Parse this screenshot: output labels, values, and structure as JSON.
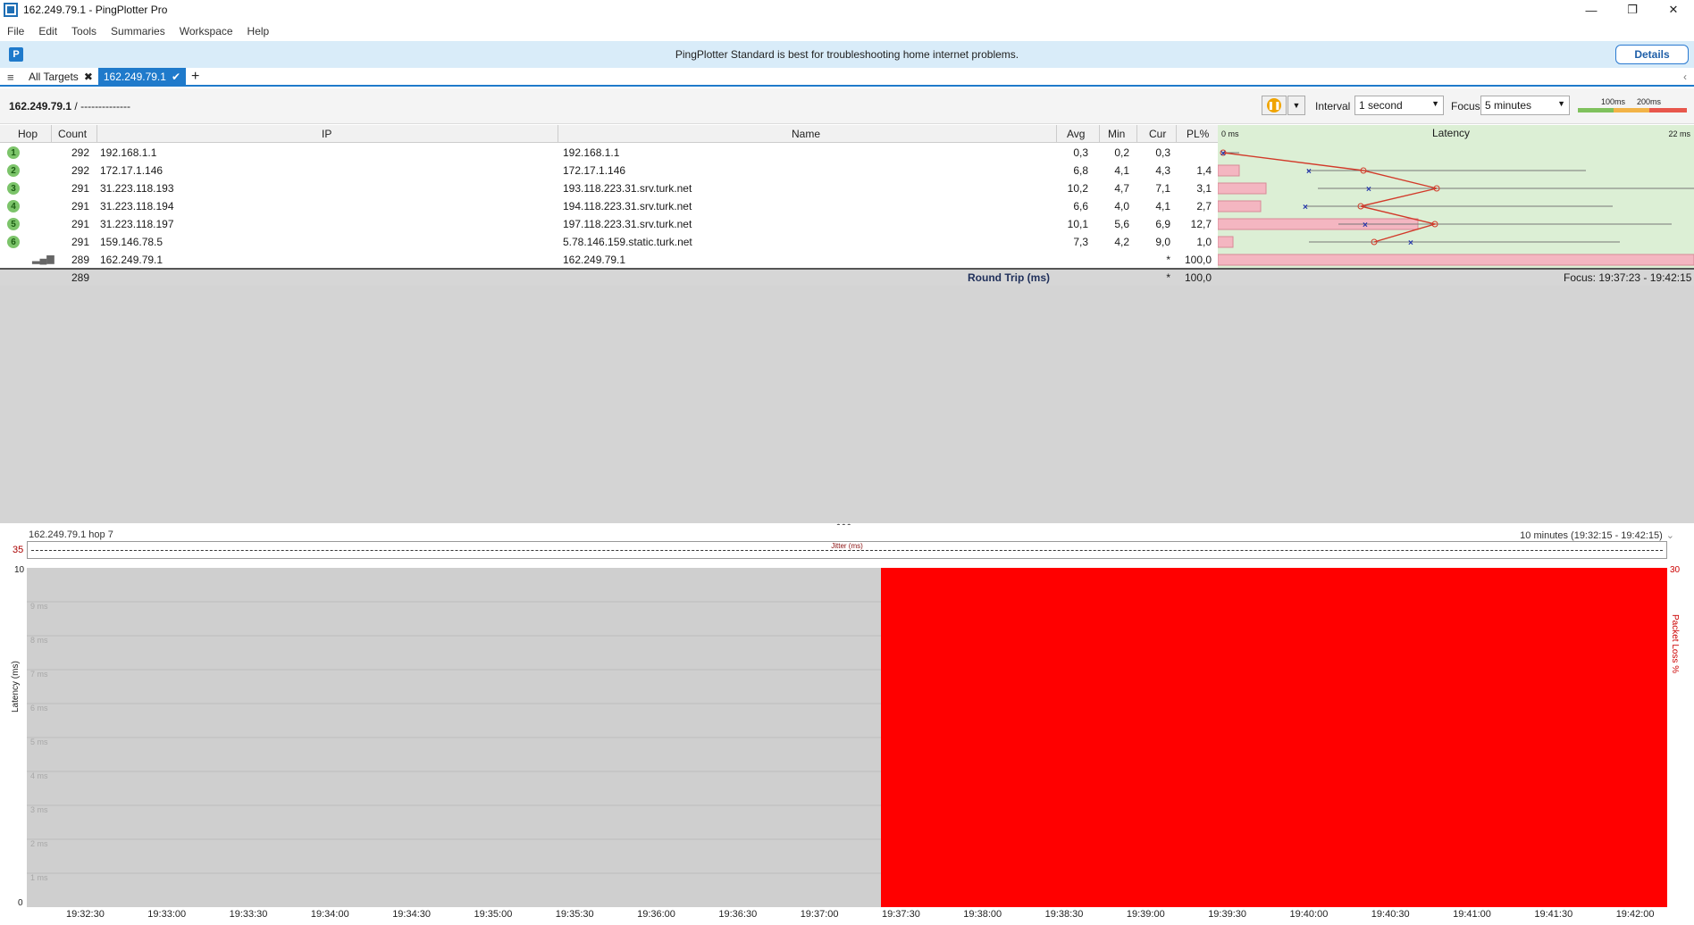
{
  "window": {
    "title": "162.249.79.1 - PingPlotter Pro",
    "controls": [
      "—",
      "❐",
      "✕"
    ]
  },
  "menu": [
    "File",
    "Edit",
    "Tools",
    "Summaries",
    "Workspace",
    "Help"
  ],
  "banner": {
    "message": "PingPlotter Standard is best for troubleshooting home internet problems.",
    "details_label": "Details"
  },
  "tabs": {
    "all_targets": "All Targets",
    "active": "162.249.79.1",
    "add": "+"
  },
  "toolbar": {
    "crumb_target": "162.249.79.1",
    "crumb_rest": " /  --------------",
    "interval_label": "Interval",
    "interval_value": "1 second",
    "focus_label": "Focus",
    "focus_value": "5 minutes",
    "scale_100": "100ms",
    "scale_200": "200ms"
  },
  "table": {
    "headers": {
      "hop": "Hop",
      "count": "Count",
      "ip": "IP",
      "name": "Name",
      "avg": "Avg",
      "min": "Min",
      "cur": "Cur",
      "pl": "PL%",
      "latency": "Latency",
      "lat_min": "0 ms",
      "lat_max": "22 ms"
    },
    "rows": [
      {
        "hop": "1",
        "count": "292",
        "ip": "192.168.1.1",
        "name": "192.168.1.1",
        "avg": "0,3",
        "min": "0,2",
        "cur": "0,3",
        "pl": ""
      },
      {
        "hop": "2",
        "count": "292",
        "ip": "172.17.1.146",
        "name": "172.17.1.146",
        "avg": "6,8",
        "min": "4,1",
        "cur": "4,3",
        "pl": "1,4"
      },
      {
        "hop": "3",
        "count": "291",
        "ip": "31.223.118.193",
        "name": "193.118.223.31.srv.turk.net",
        "avg": "10,2",
        "min": "4,7",
        "cur": "7,1",
        "pl": "3,1"
      },
      {
        "hop": "4",
        "count": "291",
        "ip": "31.223.118.194",
        "name": "194.118.223.31.srv.turk.net",
        "avg": "6,6",
        "min": "4,0",
        "cur": "4,1",
        "pl": "2,7"
      },
      {
        "hop": "5",
        "count": "291",
        "ip": "31.223.118.197",
        "name": "197.118.223.31.srv.turk.net",
        "avg": "10,1",
        "min": "5,6",
        "cur": "6,9",
        "pl": "12,7"
      },
      {
        "hop": "6",
        "count": "291",
        "ip": "159.146.78.5",
        "name": "5.78.146.159.static.turk.net",
        "avg": "7,3",
        "min": "4,2",
        "cur": "9,0",
        "pl": "1,0"
      },
      {
        "hop": "",
        "count": "289",
        "ip": "162.249.79.1",
        "name": "162.249.79.1",
        "avg": "",
        "min": "",
        "cur": "*",
        "pl": "100,0"
      }
    ],
    "round_trip": {
      "count": "289",
      "label": "Round Trip (ms)",
      "cur": "*",
      "pl": "100,0",
      "focus": "Focus: 19:37:23 - 19:42:15"
    }
  },
  "bottom_chart": {
    "title_left": "162.249.79.1 hop 7",
    "title_right": "10 minutes (19:32:15 - 19:42:15)",
    "jitter_label": "Jitter (ms)",
    "jitter_max": "35",
    "y_left_top": "10",
    "y_left_bottom": "0",
    "y_right_top": "30",
    "y_title_left": "Latency (ms)",
    "y_title_right": "Packet Loss %",
    "y_ticks": [
      "9 ms",
      "8 ms",
      "7 ms",
      "6 ms",
      "5 ms",
      "4 ms",
      "3 ms",
      "2 ms",
      "1 ms"
    ],
    "x_ticks": [
      "19:32:30",
      "19:33:00",
      "19:33:30",
      "19:34:00",
      "19:34:30",
      "19:35:00",
      "19:35:30",
      "19:36:00",
      "19:36:30",
      "19:37:00",
      "19:37:30",
      "19:38:00",
      "19:38:30",
      "19:39:00",
      "19:39:30",
      "19:40:00",
      "19:40:30",
      "19:41:00",
      "19:41:30",
      "19:42:00"
    ],
    "colors": {
      "loss": "#ff0000",
      "background": "#cfcfcf"
    }
  }
}
